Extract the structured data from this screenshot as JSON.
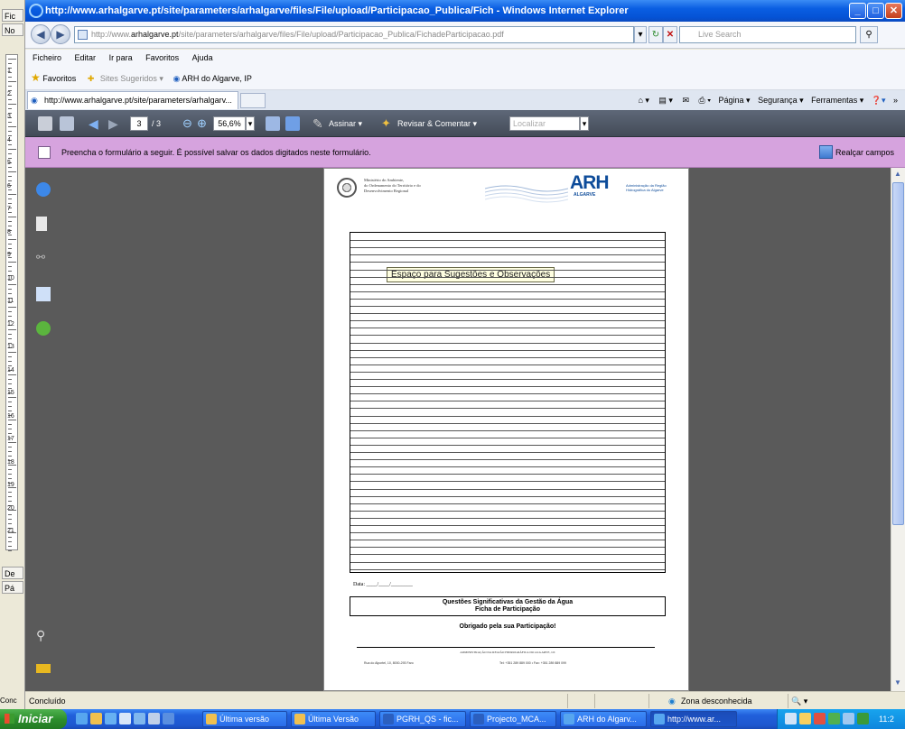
{
  "window": {
    "title": "http://www.arhalgarve.pt/site/parameters/arhalgarve/files/File/upload/Participacao_Publica/Fich - Windows Internet Explorer"
  },
  "address": {
    "prefix": "http://www.",
    "domain": "arhalgarve.pt",
    "path": "/site/parameters/arhalgarve/files/File/upload/Participacao_Publica/FichadeParticipacao.pdf"
  },
  "search": {
    "placeholder": "Live Search"
  },
  "menu": [
    "Ficheiro",
    "Editar",
    "Ir para",
    "Favoritos",
    "Ajuda"
  ],
  "favorites": {
    "label": "Favoritos",
    "sites_sugeridos": "Sites Sugeridos ▾",
    "link": "ARH do Algarve, IP"
  },
  "tab": {
    "label": "http://www.arhalgarve.pt/site/parameters/arhalgarv..."
  },
  "commandbar": [
    "Página ▾",
    "Segurança ▾",
    "Ferramentas ▾"
  ],
  "pdf_toolbar": {
    "page_current": "3",
    "page_total": "/ 3",
    "zoom": "56,6%",
    "sign": "Assinar ▾",
    "review": "Revisar & Comentar ▾",
    "find_placeholder": "Localizar"
  },
  "formbar": {
    "message": "Preencha o formulário a seguir. É possível salvar os dados digitados neste formulário.",
    "highlight": "Realçar campos"
  },
  "document": {
    "ministry": [
      "Ministério do Ambiente,",
      "do Ordenamento do Território e do",
      "Desenvolvimento Regional"
    ],
    "logo_big": "ARH",
    "logo_sub": "ALGARVE",
    "logo_side": "Administração da Região Hidrográfica do Algarve",
    "tooltip": "Espaço para Sugestões e Observações",
    "date_label": "Data: ____/____/________",
    "title_line1": "Questões Significativas da Gestão da Água",
    "title_line2": "Ficha de Participação",
    "thanks": "Obrigado pela sua Participação!",
    "admin": "ADMINISTRAÇÃO DA REGIÃO HIDROGRÁFICA DO ALGARVE, I.P.",
    "footer_left": "Rua do Alportel, 10, 8000-293 Faro",
    "footer_right": "Tel: +351 289 889 000 • Fax: +351 289 889 099"
  },
  "status": {
    "text": "Concluído",
    "zone": "Zona desconhecida",
    "left_label": "Conc",
    "zoom_icon": "🔍 ▾"
  },
  "left_app": {
    "buttons": [
      "Fic",
      "No",
      "De",
      "Pá"
    ],
    "ruler": [
      "1",
      "2",
      "3",
      "4",
      "5",
      "6",
      "7",
      "8",
      "9",
      "10",
      "11",
      "12",
      "13",
      "14",
      "15",
      "16",
      "17",
      "18",
      "19",
      "20",
      "21"
    ]
  },
  "taskbar": {
    "start": "Iniciar",
    "buttons": [
      "Última versão",
      "Última Versão",
      "PGRH_QS - fic...",
      "Projecto_MCA...",
      "ARH do Algarv...",
      "http://www.ar..."
    ],
    "clock": "11:2"
  }
}
